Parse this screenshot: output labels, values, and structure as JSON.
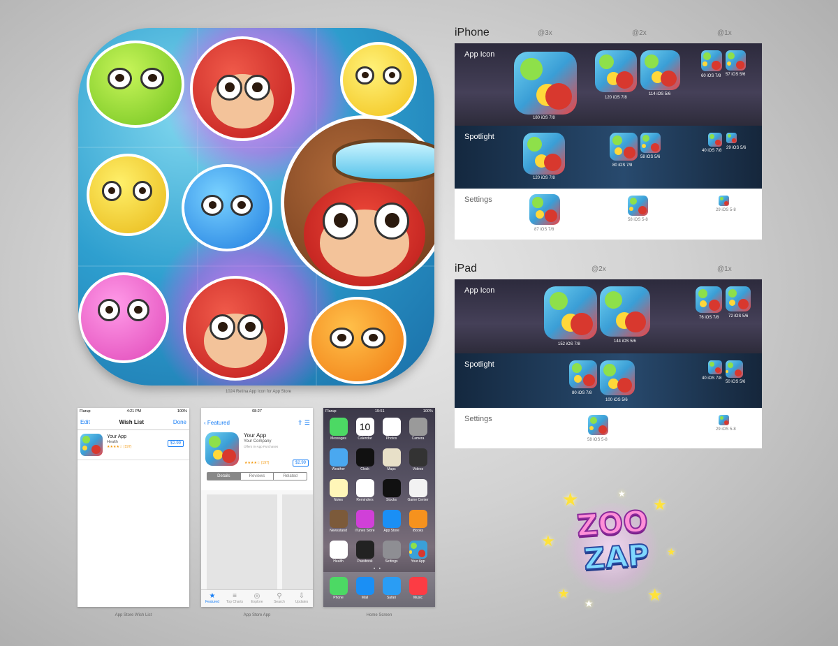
{
  "big_icon_caption": "1024 Retina App Icon for App Store",
  "screens": [
    {
      "caption": "App Store Wish List",
      "status": {
        "carrier": "Flarup",
        "time": "4:21 PM",
        "battery": "100%"
      },
      "nav": {
        "left": "Edit",
        "title": "Wish List",
        "right": "Done"
      },
      "item": {
        "name": "Your App",
        "category": "Health",
        "rating": "★★★★☆ (197)",
        "price": "$2.99"
      }
    },
    {
      "caption": "App Store App",
      "status": {
        "carrier": "",
        "time": "08:27",
        "battery": ""
      },
      "nav": {
        "back": "Featured"
      },
      "item": {
        "name": "Your App",
        "company": "Your Company",
        "iap": "Offers In-App Purchases",
        "rating": "★★★★☆ (197)",
        "price": "$2.99"
      },
      "segments": [
        "Details",
        "Reviews",
        "Related"
      ],
      "tabs": [
        "Featured",
        "Top Charts",
        "Explore",
        "Search",
        "Updates"
      ]
    },
    {
      "caption": "Home Screen",
      "status": {
        "carrier": "Flarup",
        "time": "19:51",
        "battery": "100%"
      },
      "apps": [
        {
          "label": "Messages",
          "color": "#4cd964"
        },
        {
          "label": "Calendar",
          "color": "#ffffff"
        },
        {
          "label": "Photos",
          "color": "#ffffff"
        },
        {
          "label": "Camera",
          "color": "#9a9a9a"
        },
        {
          "label": "Weather",
          "color": "#4aa8f0"
        },
        {
          "label": "Clock",
          "color": "#111111"
        },
        {
          "label": "Maps",
          "color": "#e8e0c8"
        },
        {
          "label": "Videos",
          "color": "#333333"
        },
        {
          "label": "Notes",
          "color": "#fff6b8"
        },
        {
          "label": "Reminders",
          "color": "#ffffff"
        },
        {
          "label": "Stocks",
          "color": "#111111"
        },
        {
          "label": "Game Center",
          "color": "#f2f2f2"
        },
        {
          "label": "Newsstand",
          "color": "#7c5a3a"
        },
        {
          "label": "iTunes Store",
          "color": "#d040d8"
        },
        {
          "label": "App Store",
          "color": "#1a8ff5"
        },
        {
          "label": "iBooks",
          "color": "#f6921e"
        },
        {
          "label": "Health",
          "color": "#ffffff"
        },
        {
          "label": "Passbook",
          "color": "#222222"
        },
        {
          "label": "Settings",
          "color": "#8e8e93"
        },
        {
          "label": "Your App",
          "color": "#3aa0d8"
        }
      ],
      "dock": [
        {
          "label": "Phone",
          "color": "#4cd964"
        },
        {
          "label": "Mail",
          "color": "#1a8ff5"
        },
        {
          "label": "Safari",
          "color": "#2a9df4"
        },
        {
          "label": "Music",
          "color": "#fc3c44"
        }
      ],
      "calendar_day": "10"
    }
  ],
  "iphone": {
    "title": "iPhone",
    "columns": [
      "@3x",
      "@2x",
      "@1x"
    ],
    "rows": [
      {
        "label": "App Icon",
        "icons": [
          "180 iOS 7/8",
          "120 iOS 7/8",
          "114 iOS 5/6",
          "60 iOS 7/8",
          "57 iOS 5/6"
        ]
      },
      {
        "label": "Spotlight",
        "icons": [
          "120 iOS 7/8",
          "80 iOS 7/8",
          "58 iOS 5/6",
          "40 iOS 7/8",
          "29 iOS 5/6"
        ]
      },
      {
        "label": "Settings",
        "icons": [
          "87 iOS 7/8",
          "58 iOS 5-8",
          "29 iOS 5-8"
        ]
      }
    ]
  },
  "ipad": {
    "title": "iPad",
    "columns": [
      "@2x",
      "@1x"
    ],
    "rows": [
      {
        "label": "App Icon",
        "icons": [
          "152 iOS 7/8",
          "144 iOS 5/6",
          "76 iOS 7/8",
          "72 iOS 5/6"
        ]
      },
      {
        "label": "Spotlight",
        "icons": [
          "80 iOS 7/8",
          "100 iOS 5/6",
          "40 iOS 7/8",
          "50 iOS 5/6"
        ]
      },
      {
        "label": "Settings",
        "icons": [
          "58 iOS 5-8",
          "29 iOS 5-8"
        ]
      }
    ]
  },
  "logo": {
    "line1": "ZOO",
    "line2": "ZAP"
  }
}
